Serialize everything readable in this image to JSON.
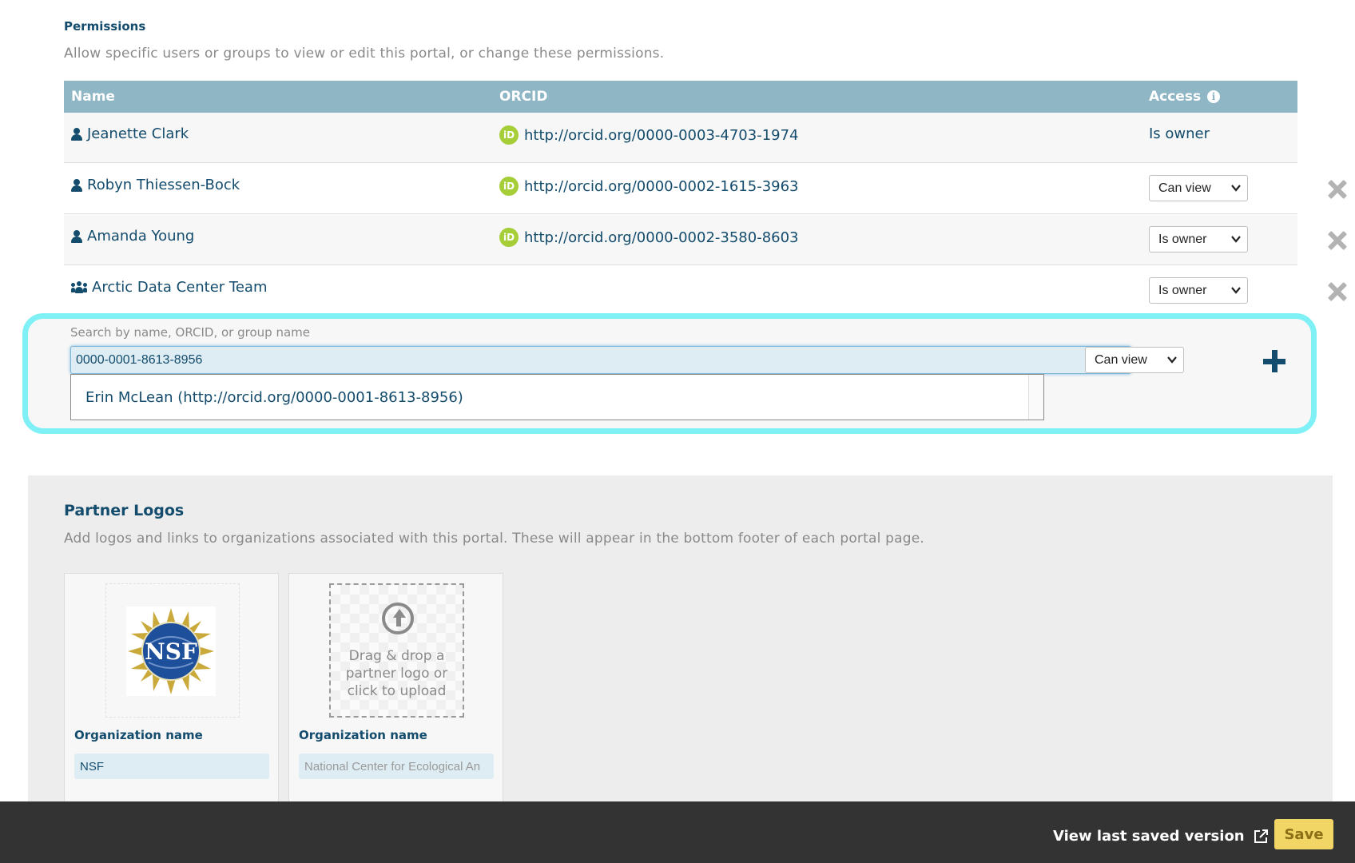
{
  "permissions": {
    "heading": "Permissions",
    "description": "Allow specific users or groups to view or edit this portal, or change these permissions.",
    "columns": {
      "name": "Name",
      "orcid": "ORCID",
      "access": "Access"
    },
    "rows": [
      {
        "name": "Jeanette Clark",
        "type": "user",
        "orcid": "http://orcid.org/0000-0003-4703-1974",
        "access": "Is owner",
        "editable": false
      },
      {
        "name": "Robyn Thiessen-Bock",
        "type": "user",
        "orcid": "http://orcid.org/0000-0002-1615-3963",
        "access": "Can view",
        "editable": true
      },
      {
        "name": "Amanda Young",
        "type": "user",
        "orcid": "http://orcid.org/0000-0002-3580-8603",
        "access": "Is owner",
        "editable": true
      },
      {
        "name": "Arctic Data Center Team",
        "type": "group",
        "orcid": "",
        "access": "Is owner",
        "editable": true
      }
    ],
    "add": {
      "label": "Search by name, ORCID, or group name",
      "value": "0000-0001-8613-8956",
      "suggestion": "Erin McLean (http://orcid.org/0000-0001-8613-8956)",
      "access": "Can view"
    }
  },
  "partner_logos": {
    "heading": "Partner Logos",
    "description": "Add logos and links to organizations associated with this portal. These will appear in the bottom footer of each portal page.",
    "cards": [
      {
        "logo_text": "NSF",
        "org_label": "Organization name",
        "org_value": "NSF",
        "org_placeholder": ""
      },
      {
        "upload_text": "Drag & drop a partner logo or click to upload",
        "org_label": "Organization name",
        "org_value": "",
        "org_placeholder": "National Center for Ecological An"
      }
    ]
  },
  "footer": {
    "view_last_saved": "View last saved version",
    "save": "Save"
  },
  "colors": {
    "primary": "#144c6d",
    "table_header": "#8fb6c5",
    "orcid_green": "#a6ce39",
    "highlight": "#7ff0f5",
    "save_button": "#f1d666",
    "footer_bg": "#333333"
  },
  "icons": {
    "user": "user-icon",
    "group": "group-icon",
    "orcid": "orcid-icon",
    "info": "info-icon",
    "remove": "close-icon",
    "add": "plus-icon",
    "upload": "upload-icon",
    "external_link": "external-link-icon"
  }
}
